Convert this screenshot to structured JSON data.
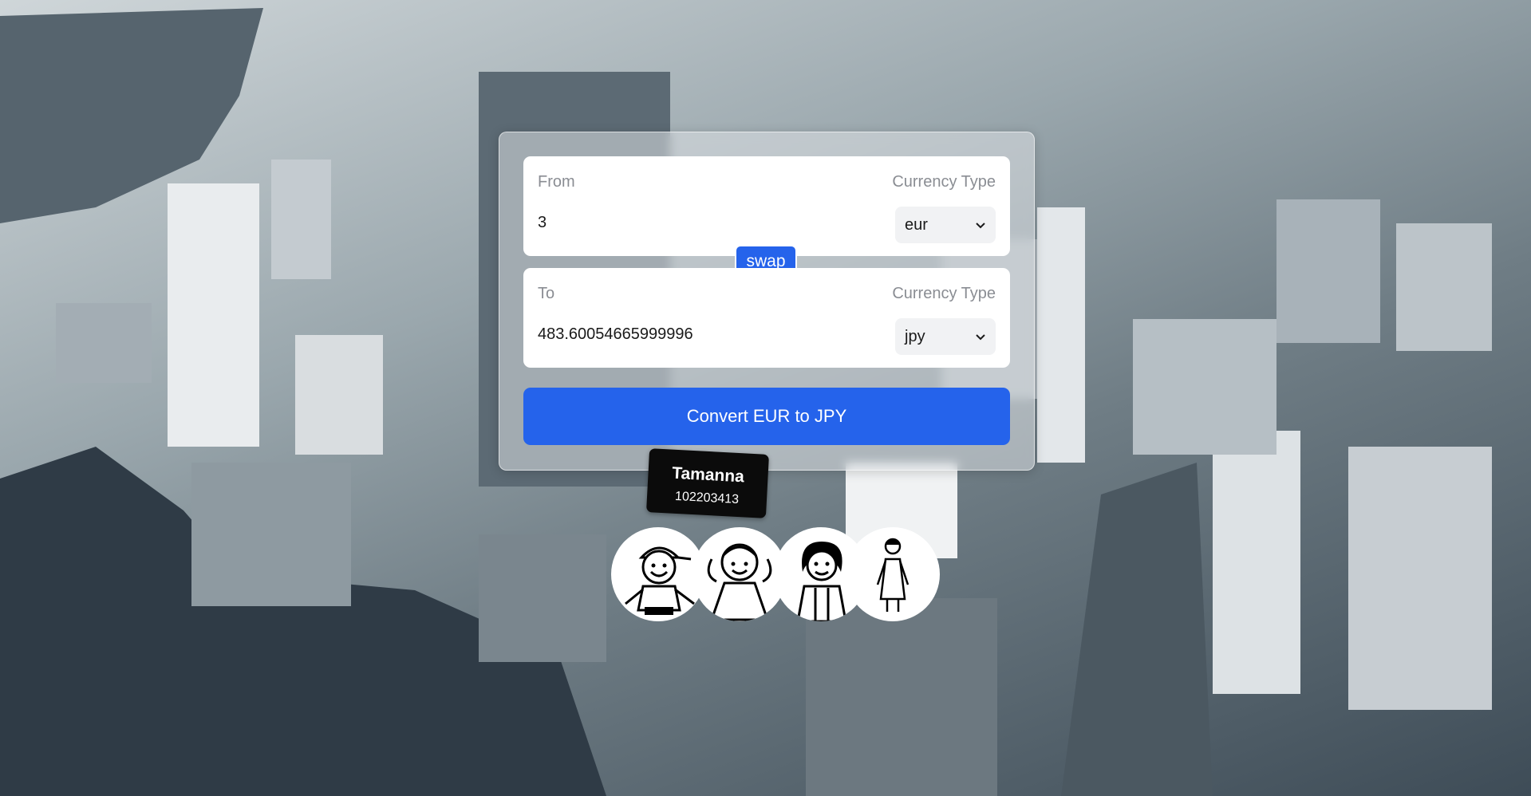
{
  "converter": {
    "from_label": "From",
    "from_currency_label": "Currency Type",
    "from_amount": "3",
    "from_currency": "eur",
    "swap_label": "swap",
    "to_label": "To",
    "to_currency_label": "Currency Type",
    "to_amount": "483.60054665999996",
    "to_currency": "jpy",
    "convert_label": "Convert EUR to JPY"
  },
  "tooltip": {
    "name": "Tamanna",
    "id": "102203413"
  },
  "avatars": [
    {
      "icon": "boy-cap-avatar-icon"
    },
    {
      "icon": "girl-pigtails-avatar-icon"
    },
    {
      "icon": "woman-dark-hair-avatar-icon"
    },
    {
      "icon": "woman-standing-avatar-icon"
    }
  ],
  "colors": {
    "accent": "#2563eb",
    "tooltip_bg": "#0b0b0b"
  }
}
